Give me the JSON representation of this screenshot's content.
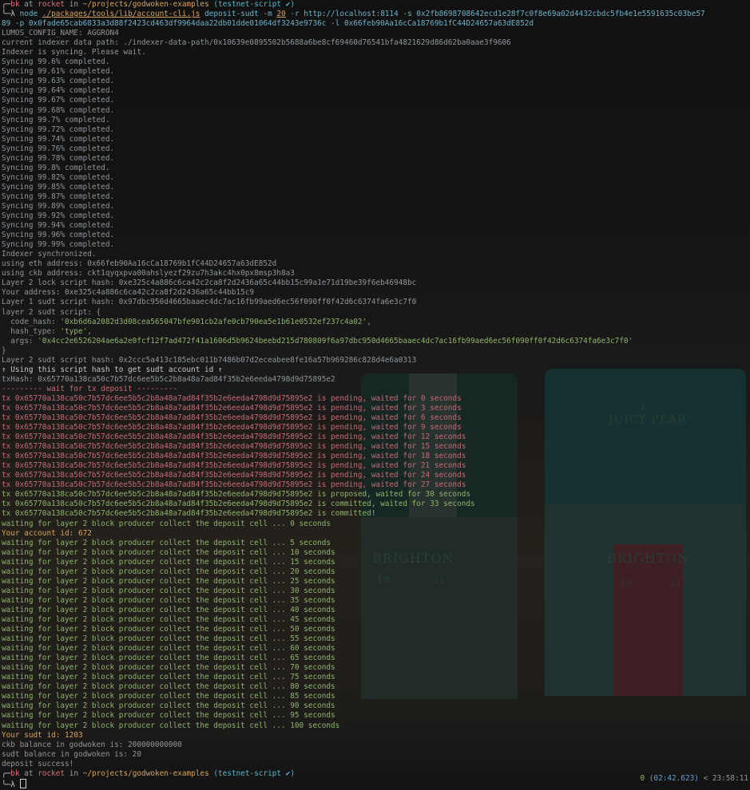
{
  "prompt": {
    "glyph_top": "╭─",
    "glyph_bottom": "╰─",
    "lambda": "λ",
    "user": "bk",
    "at": "at",
    "host": "rocket",
    "in": "in",
    "path": "~/projects/godwoken-examples",
    "branch": "(testnet-script ✔)"
  },
  "command": {
    "node": "node",
    "script": "./packages/tools/lib/account-cli.js",
    "args_1": "deposit-sudt -m",
    "m_value": "20",
    "args_2": "-r http://localhost:8114 -s 0x2fb8698708642ecd1e28f7c0f8e69a02d4432cbdc5fb4e1e5591635c03be57",
    "args_3": "89 -p 0x0fade65cab6833a3d88f2423cd463df9964daa22db01dde01064df3243e9736c -l 0x66feb90Aa16cCa18769b1fC44D24657a63dE852d"
  },
  "header_lines": [
    "LUMOS_CONFIG_NAME: AGGRON4",
    "current indexer data path: ./indexer-data-path/0x10639e0895502b5688a6be8cf69460d76541bfa4821629d86d62ba0aae3f9606",
    "Indexer is syncing. Please wait."
  ],
  "sync_lines": [
    "Syncing 99.6% completed.",
    "Syncing 99.61% completed.",
    "Syncing 99.63% completed.",
    "Syncing 99.64% completed.",
    "Syncing 99.67% completed.",
    "Syncing 99.68% completed.",
    "Syncing 99.7% completed.",
    "Syncing 99.72% completed.",
    "Syncing 99.74% completed.",
    "Syncing 99.76% completed.",
    "Syncing 99.78% completed.",
    "Syncing 99.8% completed.",
    "Syncing 99.82% completed.",
    "Syncing 99.85% completed.",
    "Syncing 99.87% completed.",
    "Syncing 99.89% completed.",
    "Syncing 99.92% completed.",
    "Syncing 99.94% completed.",
    "Syncing 99.96% completed.",
    "Syncing 99.99% completed."
  ],
  "info_lines": [
    "Indexer synchronized.",
    "using eth address: 0x66feb90Aa16cCa18769b1fC44D24657a63dE852d",
    "using ckb address: ckt1qyqxpva00ahslyezf29zu7h3akc4hx0px8msp3h8a3",
    "Layer 2 lock script hash: 0xe325c4a886c6ca42c2ca8f2d2436a65c44bb15c99a1e71d19be39f6eb46948bc",
    "Your address: 0xe325c4a886c6ca42c2ca8f2d2436a65c44bb15c9",
    "Layer 1 sudt script hash: 0x97dbc950d4665baaec4dc7ac16fb99aed6ec56f090ff0f42d6c6374fa6e3c7f0",
    "layer 2 sudt script: {"
  ],
  "sudt_script": {
    "code_hash_key": "  code_hash: ",
    "code_hash": "'0xb6d6a2082d3d08cea565047bfe901cb2afe0cb790ea5e1b61e0532ef237c4a02'",
    "hash_type_key": "  hash_type: ",
    "hash_type": "'type'",
    "args_key": "  args: ",
    "args": "'0x4cc2e6526204ae6a2e0fcf12f7ad472f41a1606d5b9624beebd215d780809f6a97dbc950d4665baaec4dc7ac16fb99aed6ec56f090ff0f42d6c6374fa6e3c7f0'",
    "close": "}"
  },
  "sudt_hash_line": "Layer 2 sudt script hash: 0x2ccc5a413c185ebc011b7486b07d2eceabee8fe16a57b969286c828d4e6a0313",
  "using_hash_line": "↑ Using this script hash to get sudt account id ↑",
  "tx_hash_line": "txHash: 0x65770a138ca50c7b57dc6ee5b5c2b8a48a7ad84f35b2e6eeda4798d9d75895e2",
  "wait_header": "--------- wait for tx deposit ---------",
  "tx_lines": [
    "tx 0x65770a138ca50c7b57dc6ee5b5c2b8a48a7ad84f35b2e6eeda4798d9d75895e2 is pending, waited for 0 seconds",
    "tx 0x65770a138ca50c7b57dc6ee5b5c2b8a48a7ad84f35b2e6eeda4798d9d75895e2 is pending, waited for 3 seconds",
    "tx 0x65770a138ca50c7b57dc6ee5b5c2b8a48a7ad84f35b2e6eeda4798d9d75895e2 is pending, waited for 6 seconds",
    "tx 0x65770a138ca50c7b57dc6ee5b5c2b8a48a7ad84f35b2e6eeda4798d9d75895e2 is pending, waited for 9 seconds",
    "tx 0x65770a138ca50c7b57dc6ee5b5c2b8a48a7ad84f35b2e6eeda4798d9d75895e2 is pending, waited for 12 seconds",
    "tx 0x65770a138ca50c7b57dc6ee5b5c2b8a48a7ad84f35b2e6eeda4798d9d75895e2 is pending, waited for 15 seconds",
    "tx 0x65770a138ca50c7b57dc6ee5b5c2b8a48a7ad84f35b2e6eeda4798d9d75895e2 is pending, waited for 18 seconds",
    "tx 0x65770a138ca50c7b57dc6ee5b5c2b8a48a7ad84f35b2e6eeda4798d9d75895e2 is pending, waited for 21 seconds",
    "tx 0x65770a138ca50c7b57dc6ee5b5c2b8a48a7ad84f35b2e6eeda4798d9d75895e2 is pending, waited for 24 seconds",
    "tx 0x65770a138ca50c7b57dc6ee5b5c2b8a48a7ad84f35b2e6eeda4798d9d75895e2 is pending, waited for 27 seconds",
    "tx 0x65770a138ca50c7b57dc6ee5b5c2b8a48a7ad84f35b2e6eeda4798d9d75895e2 is proposed, waited for 30 seconds",
    "tx 0x65770a138ca50c7b57dc6ee5b5c2b8a48a7ad84f35b2e6eeda4798d9d75895e2 is committed, waited for 33 seconds",
    "tx 0x65770a138ca50c7b57dc6ee5b5c2b8a48a7ad84f35b2e6eeda4798d9d75895e2 is committed!"
  ],
  "first_wait_line": "waiting for layer 2 block producer collect the deposit cell ... 0 seconds",
  "account_id": {
    "label": "Your account id: ",
    "value": "672"
  },
  "wait_lines": [
    "waiting for layer 2 block producer collect the deposit cell ... 5 seconds",
    "waiting for layer 2 block producer collect the deposit cell ... 10 seconds",
    "waiting for layer 2 block producer collect the deposit cell ... 15 seconds",
    "waiting for layer 2 block producer collect the deposit cell ... 20 seconds",
    "waiting for layer 2 block producer collect the deposit cell ... 25 seconds",
    "waiting for layer 2 block producer collect the deposit cell ... 30 seconds",
    "waiting for layer 2 block producer collect the deposit cell ... 35 seconds",
    "waiting for layer 2 block producer collect the deposit cell ... 40 seconds",
    "waiting for layer 2 block producer collect the deposit cell ... 45 seconds",
    "waiting for layer 2 block producer collect the deposit cell ... 50 seconds",
    "waiting for layer 2 block producer collect the deposit cell ... 55 seconds",
    "waiting for layer 2 block producer collect the deposit cell ... 60 seconds",
    "waiting for layer 2 block producer collect the deposit cell ... 65 seconds",
    "waiting for layer 2 block producer collect the deposit cell ... 70 seconds",
    "waiting for layer 2 block producer collect the deposit cell ... 75 seconds",
    "waiting for layer 2 block producer collect the deposit cell ... 80 seconds",
    "waiting for layer 2 block producer collect the deposit cell ... 85 seconds",
    "waiting for layer 2 block producer collect the deposit cell ... 90 seconds",
    "waiting for layer 2 block producer collect the deposit cell ... 95 seconds",
    "waiting for layer 2 block producer collect the deposit cell ... 100 seconds"
  ],
  "sudt_id": {
    "label": "Your sudt id: ",
    "value": "1203"
  },
  "final_lines": [
    "ckb balance in godwoken is: 200000000000",
    "sudt balance in godwoken is: 20",
    "deposit success!"
  ],
  "status": {
    "exit_code": "0",
    "duration": "(02:42.623)",
    "sep": "<",
    "clock": "23:58:11"
  },
  "wallpaper": {
    "can_number": "3",
    "can_flavor": "JUICY PEAR",
    "brand": "BRIGHTON",
    "year_left": "19",
    "year_right": "21"
  },
  "colors": {
    "background": "#141414",
    "text": "#8f9599",
    "user_host": "#e06c7b",
    "path": "#d6a35a",
    "branch": "#58b4c8",
    "string": "#8fb36b"
  }
}
